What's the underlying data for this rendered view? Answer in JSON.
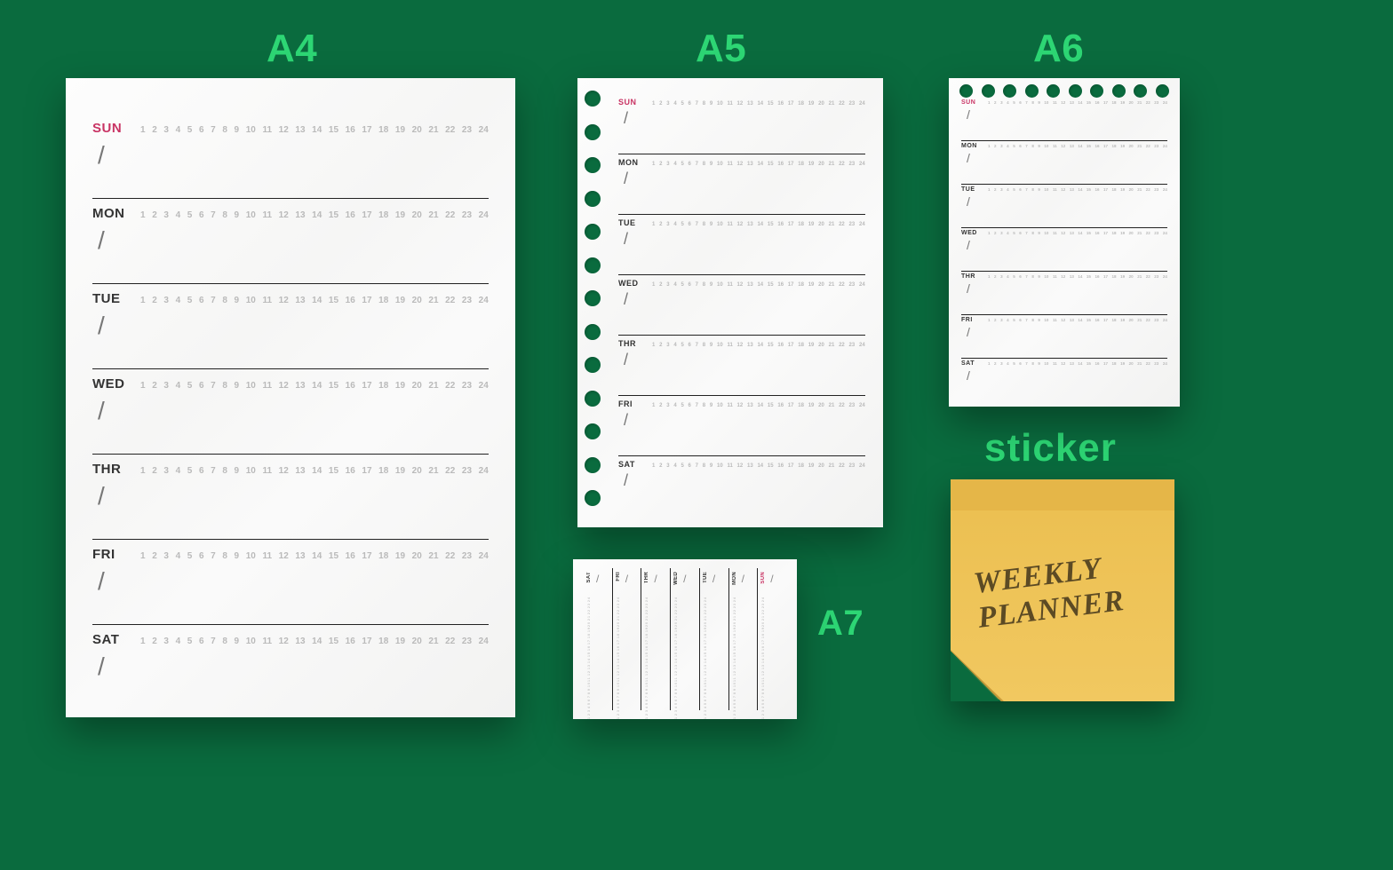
{
  "labels": {
    "a4": "A4",
    "a5": "A5",
    "a6": "A6",
    "a7": "A7",
    "sticker": "sticker"
  },
  "days": [
    "SUN",
    "MON",
    "TUE",
    "WED",
    "THR",
    "FRI",
    "SAT"
  ],
  "hours": [
    "1",
    "2",
    "3",
    "4",
    "5",
    "6",
    "7",
    "8",
    "9",
    "10",
    "11",
    "12",
    "13",
    "14",
    "15",
    "16",
    "17",
    "18",
    "19",
    "20",
    "21",
    "22",
    "23",
    "24"
  ],
  "slash": "/",
  "sticker_text_line1": "WEEKLY",
  "sticker_text_line2": "PLANNER"
}
